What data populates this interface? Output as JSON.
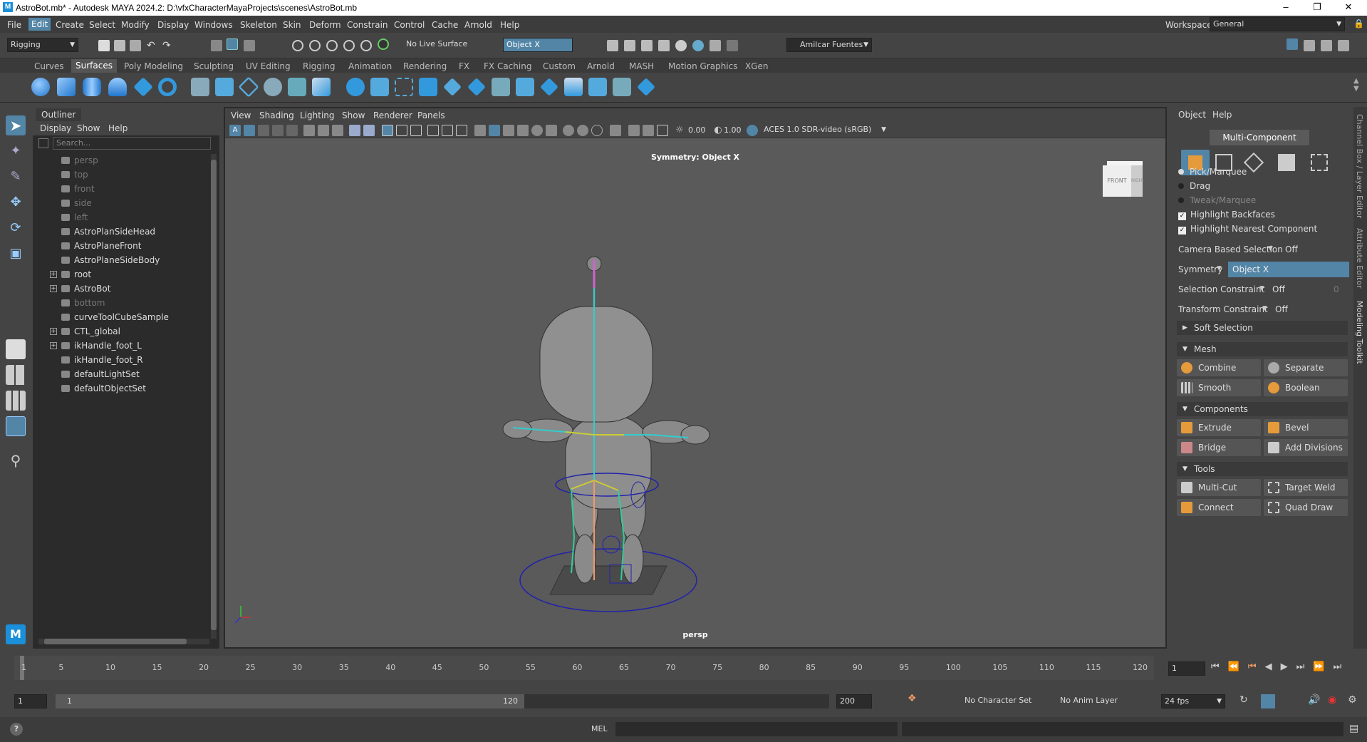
{
  "window": {
    "title": "AstroBot.mb* - Autodesk MAYA 2024.2: D:\\vfxCharacterMayaProjects\\scenes\\AstroBot.mb",
    "logo": "M"
  },
  "menus": [
    "File",
    "Edit",
    "Create",
    "Select",
    "Modify",
    "Display",
    "Windows",
    "Skeleton",
    "Skin",
    "Deform",
    "Constrain",
    "Control",
    "Cache",
    "Arnold",
    "Help"
  ],
  "workspace": {
    "label": "Workspace:",
    "value": "General"
  },
  "status": {
    "menu_set": "Rigging",
    "live_surface": "No Live Surface",
    "symmetry": "Object X",
    "user": "Amilcar Fuentes"
  },
  "shelf_tabs": [
    "Curves",
    "Surfaces",
    "Poly Modeling",
    "Sculpting",
    "UV Editing",
    "Rigging",
    "Animation",
    "Rendering",
    "FX",
    "FX Caching",
    "Custom",
    "Arnold",
    "MASH",
    "Motion Graphics",
    "XGen"
  ],
  "shelf_active": "Surfaces",
  "outliner": {
    "tab": "Outliner",
    "menu": [
      "Display",
      "Show",
      "Help"
    ],
    "search_placeholder": "Search...",
    "items": [
      {
        "label": "persp",
        "dim": true,
        "expand": false,
        "icon": "camera-icon"
      },
      {
        "label": "top",
        "dim": true,
        "expand": false,
        "icon": "camera-icon"
      },
      {
        "label": "front",
        "dim": true,
        "expand": false,
        "icon": "camera-icon"
      },
      {
        "label": "side",
        "dim": true,
        "expand": false,
        "icon": "camera-icon"
      },
      {
        "label": "left",
        "dim": true,
        "expand": false,
        "icon": "camera-icon"
      },
      {
        "label": "AstroPlanSideHead",
        "dim": false,
        "expand": false,
        "icon": "mesh-icon"
      },
      {
        "label": "AstroPlaneFront",
        "dim": false,
        "expand": false,
        "icon": "mesh-icon"
      },
      {
        "label": "AstroPlaneSideBody",
        "dim": false,
        "expand": false,
        "icon": "mesh-icon"
      },
      {
        "label": "root",
        "dim": false,
        "expand": true,
        "icon": "joint-icon"
      },
      {
        "label": "AstroBot",
        "dim": false,
        "expand": true,
        "icon": "mesh-icon"
      },
      {
        "label": "bottom",
        "dim": true,
        "expand": false,
        "icon": "camera-icon"
      },
      {
        "label": "curveToolCubeSample",
        "dim": false,
        "expand": false,
        "icon": "curve-icon"
      },
      {
        "label": "CTL_global",
        "dim": false,
        "expand": true,
        "icon": "curve-icon"
      },
      {
        "label": "ikHandle_foot_L",
        "dim": false,
        "expand": true,
        "icon": "ik-icon"
      },
      {
        "label": "ikHandle_foot_R",
        "dim": false,
        "expand": false,
        "icon": "ik-icon"
      },
      {
        "label": "defaultLightSet",
        "dim": false,
        "expand": false,
        "icon": "set-icon"
      },
      {
        "label": "defaultObjectSet",
        "dim": false,
        "expand": false,
        "icon": "set-icon"
      }
    ]
  },
  "viewport": {
    "menu": [
      "View",
      "Shading",
      "Lighting",
      "Show",
      "Renderer",
      "Panels"
    ],
    "exposure": "0.00",
    "gamma": "1.00",
    "color_space": "ACES 1.0 SDR-video (sRGB)",
    "symmetry_label": "Symmetry: Object X",
    "camera": "persp",
    "cube_front": "FRONT",
    "cube_right": "RIGHT"
  },
  "toolkit": {
    "menu": [
      "Object",
      "Help"
    ],
    "mode": "Multi-Component",
    "pick_options": [
      {
        "label": "Pick/Marquee",
        "on": true,
        "dim": false
      },
      {
        "label": "Drag",
        "on": false,
        "dim": false
      },
      {
        "label": "Tweak/Marquee",
        "on": false,
        "dim": true
      }
    ],
    "checks": [
      "Highlight Backfaces",
      "Highlight Nearest Component"
    ],
    "camera_based": {
      "label": "Camera Based Selection",
      "value": "Off"
    },
    "symmetry": {
      "label": "Symmetry",
      "value": "Object X"
    },
    "sel_constraint": {
      "label": "Selection Constraint",
      "value": "Off",
      "num": "0"
    },
    "transform_constraint": {
      "label": "Transform Constraint",
      "value": "Off"
    },
    "soft_selection": "Soft Selection",
    "mesh": {
      "title": "Mesh",
      "buttons": [
        "Combine",
        "Separate",
        "Smooth",
        "Boolean"
      ]
    },
    "components": {
      "title": "Components",
      "buttons": [
        "Extrude",
        "Bevel",
        "Bridge",
        "Add Divisions"
      ]
    },
    "tools": {
      "title": "Tools",
      "buttons": [
        "Multi-Cut",
        "Target Weld",
        "Connect",
        "Quad Draw"
      ]
    }
  },
  "side_tabs": [
    "Channel Box / Layer Editor",
    "Attribute Editor",
    "Modeling Toolkit"
  ],
  "timeline": {
    "ticks": [
      "1",
      "5",
      "10",
      "15",
      "20",
      "25",
      "30",
      "35",
      "40",
      "45",
      "50",
      "55",
      "60",
      "65",
      "70",
      "75",
      "80",
      "85",
      "90",
      "95",
      "100",
      "105",
      "110",
      "115",
      "120"
    ],
    "current_frame": "1"
  },
  "range": {
    "start": "1",
    "inner_start": "1",
    "inner_end": "120",
    "end": "200",
    "character_set": "No Character Set",
    "anim_layer": "No Anim Layer",
    "fps": "24 fps"
  },
  "command": {
    "lang": "MEL"
  }
}
